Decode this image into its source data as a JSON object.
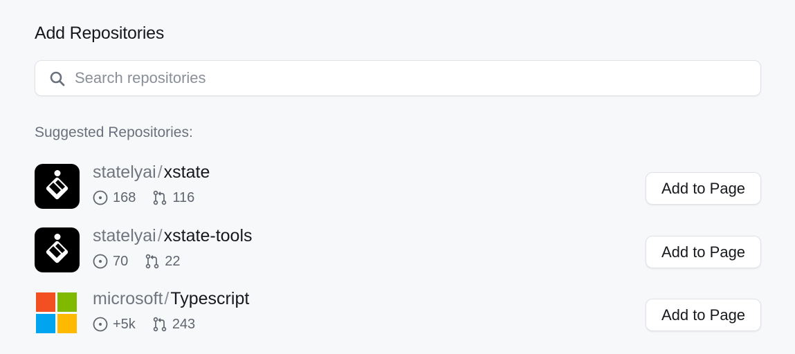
{
  "header": {
    "title": "Add Repositories"
  },
  "search": {
    "placeholder": "Search repositories",
    "value": ""
  },
  "suggested": {
    "label": "Suggested Repositories:",
    "repos": [
      {
        "owner": "statelyai",
        "separator": "/",
        "name": "xstate",
        "issues": "168",
        "pull_requests": "116",
        "logo": "stately-logo",
        "button_label": "Add to Page"
      },
      {
        "owner": "statelyai",
        "separator": "/",
        "name": "xstate-tools",
        "issues": "70",
        "pull_requests": "22",
        "logo": "stately-logo",
        "button_label": "Add to Page"
      },
      {
        "owner": "microsoft",
        "separator": "/",
        "name": "Typescript",
        "issues": "+5k",
        "pull_requests": "243",
        "logo": "microsoft-logo",
        "button_label": "Add to Page"
      }
    ]
  },
  "colors": {
    "background": "#f7f8fa",
    "text_primary": "#16181d",
    "text_secondary": "#70757e",
    "border": "#dfe2e7",
    "microsoft_red": "#f25022",
    "microsoft_green": "#7fba00",
    "microsoft_blue": "#00a4ef",
    "microsoft_yellow": "#ffb900"
  }
}
